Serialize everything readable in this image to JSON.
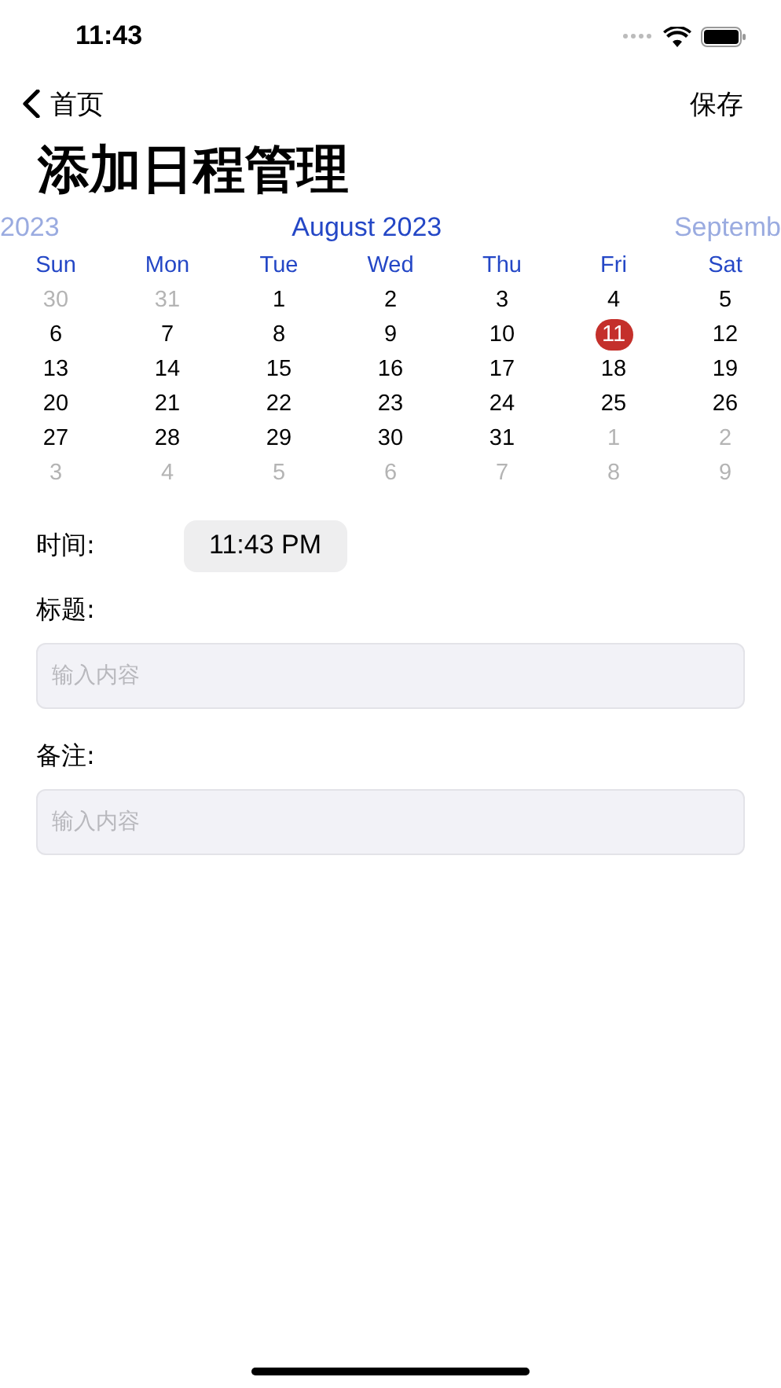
{
  "status_bar": {
    "time": "11:43"
  },
  "nav": {
    "back_label": "首页",
    "action": "保存"
  },
  "title": "添加日程管理",
  "calendar": {
    "prev_month": "2023",
    "month": "August 2023",
    "next_month": "Septemb",
    "weekdays": [
      "Sun",
      "Mon",
      "Tue",
      "Wed",
      "Thu",
      "Fri",
      "Sat"
    ],
    "weeks": [
      [
        {
          "day": "30",
          "other_month": true,
          "selected": false
        },
        {
          "day": "31",
          "other_month": true,
          "selected": false
        },
        {
          "day": "1",
          "other_month": false,
          "selected": false
        },
        {
          "day": "2",
          "other_month": false,
          "selected": false
        },
        {
          "day": "3",
          "other_month": false,
          "selected": false
        },
        {
          "day": "4",
          "other_month": false,
          "selected": false
        },
        {
          "day": "5",
          "other_month": false,
          "selected": false
        }
      ],
      [
        {
          "day": "6",
          "other_month": false,
          "selected": false
        },
        {
          "day": "7",
          "other_month": false,
          "selected": false
        },
        {
          "day": "8",
          "other_month": false,
          "selected": false
        },
        {
          "day": "9",
          "other_month": false,
          "selected": false
        },
        {
          "day": "10",
          "other_month": false,
          "selected": false
        },
        {
          "day": "11",
          "other_month": false,
          "selected": true
        },
        {
          "day": "12",
          "other_month": false,
          "selected": false
        }
      ],
      [
        {
          "day": "13",
          "other_month": false,
          "selected": false
        },
        {
          "day": "14",
          "other_month": false,
          "selected": false
        },
        {
          "day": "15",
          "other_month": false,
          "selected": false
        },
        {
          "day": "16",
          "other_month": false,
          "selected": false
        },
        {
          "day": "17",
          "other_month": false,
          "selected": false
        },
        {
          "day": "18",
          "other_month": false,
          "selected": false
        },
        {
          "day": "19",
          "other_month": false,
          "selected": false
        }
      ],
      [
        {
          "day": "20",
          "other_month": false,
          "selected": false
        },
        {
          "day": "21",
          "other_month": false,
          "selected": false
        },
        {
          "day": "22",
          "other_month": false,
          "selected": false
        },
        {
          "day": "23",
          "other_month": false,
          "selected": false
        },
        {
          "day": "24",
          "other_month": false,
          "selected": false
        },
        {
          "day": "25",
          "other_month": false,
          "selected": false
        },
        {
          "day": "26",
          "other_month": false,
          "selected": false
        }
      ],
      [
        {
          "day": "27",
          "other_month": false,
          "selected": false
        },
        {
          "day": "28",
          "other_month": false,
          "selected": false
        },
        {
          "day": "29",
          "other_month": false,
          "selected": false
        },
        {
          "day": "30",
          "other_month": false,
          "selected": false
        },
        {
          "day": "31",
          "other_month": false,
          "selected": false
        },
        {
          "day": "1",
          "other_month": true,
          "selected": false
        },
        {
          "day": "2",
          "other_month": true,
          "selected": false
        }
      ],
      [
        {
          "day": "3",
          "other_month": true,
          "selected": false
        },
        {
          "day": "4",
          "other_month": true,
          "selected": false
        },
        {
          "day": "5",
          "other_month": true,
          "selected": false
        },
        {
          "day": "6",
          "other_month": true,
          "selected": false
        },
        {
          "day": "7",
          "other_month": true,
          "selected": false
        },
        {
          "day": "8",
          "other_month": true,
          "selected": false
        },
        {
          "day": "9",
          "other_month": true,
          "selected": false
        }
      ]
    ]
  },
  "time": {
    "label": "时间:",
    "value": "11:43 PM"
  },
  "fields": [
    {
      "label": "标题:",
      "placeholder": "输入内容"
    },
    {
      "label": "备注:",
      "placeholder": "输入内容"
    }
  ]
}
